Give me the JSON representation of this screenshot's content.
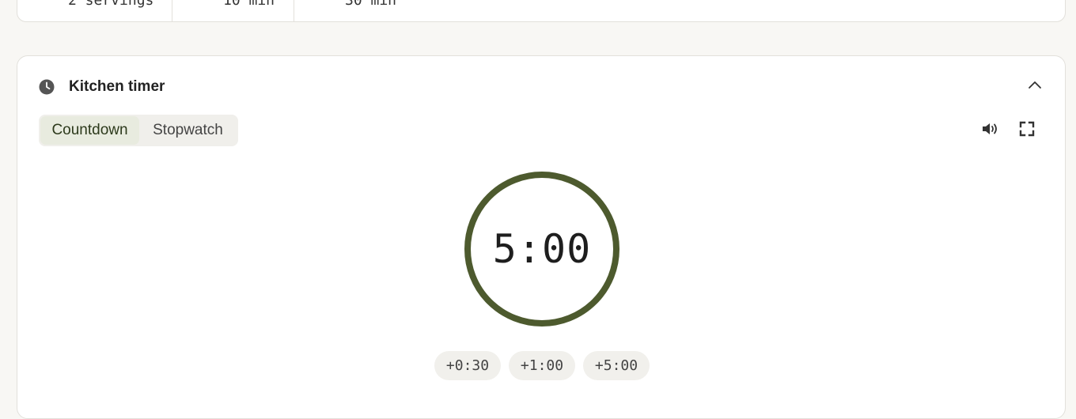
{
  "stats": {
    "servings": "2 servings",
    "prep": "10 min",
    "cook": "30 min"
  },
  "timer": {
    "title": "Kitchen timer",
    "modes": [
      "Countdown",
      "Stopwatch"
    ],
    "active_mode": "Countdown",
    "display": "5:00",
    "progress": 1.0,
    "add_buttons": [
      "+0:30",
      "+1:00",
      "+5:00"
    ],
    "icons": {
      "header": "clock-icon",
      "collapse": "chevron-up-icon",
      "sound": "speaker-icon",
      "fullscreen": "fullscreen-icon"
    },
    "accent_color": "#4d5a2e"
  }
}
